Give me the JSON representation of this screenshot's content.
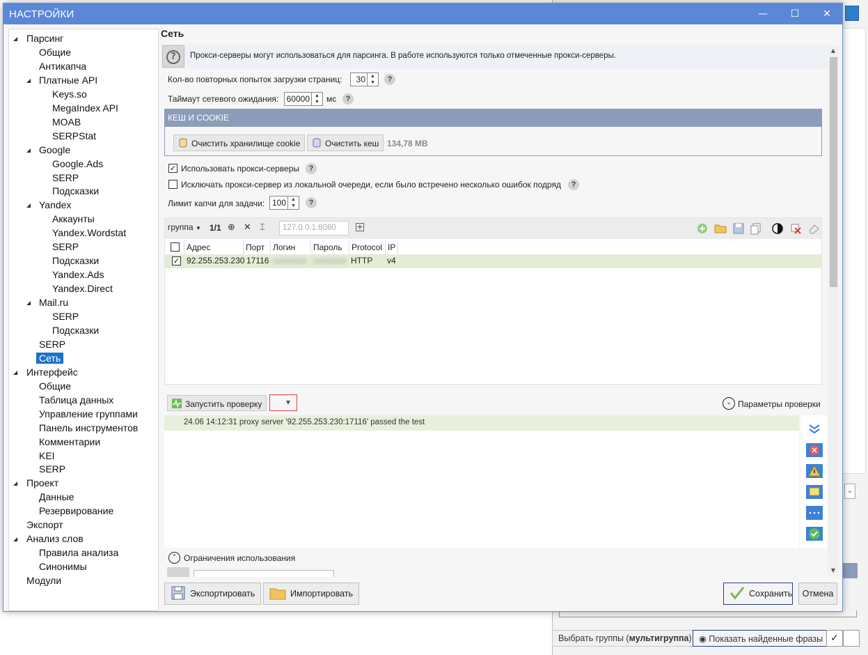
{
  "window": {
    "title": "НАСТРОЙКИ"
  },
  "tree": [
    {
      "label": "Парсинг",
      "level": 0,
      "expanded": true
    },
    {
      "label": "Общие",
      "level": 1
    },
    {
      "label": "Антикапча",
      "level": 1
    },
    {
      "label": "Платные API",
      "level": 1,
      "expanded": true
    },
    {
      "label": "Keys.so",
      "level": 2
    },
    {
      "label": "MegaIndex API",
      "level": 2
    },
    {
      "label": "MOAB",
      "level": 2
    },
    {
      "label": "SERPStat",
      "level": 2
    },
    {
      "label": "Google",
      "level": 1,
      "expanded": true
    },
    {
      "label": "Google.Ads",
      "level": 2
    },
    {
      "label": "SERP",
      "level": 2
    },
    {
      "label": "Подсказки",
      "level": 2
    },
    {
      "label": "Yandex",
      "level": 1,
      "expanded": true
    },
    {
      "label": "Аккаунты",
      "level": 2
    },
    {
      "label": "Yandex.Wordstat",
      "level": 2
    },
    {
      "label": "SERP",
      "level": 2
    },
    {
      "label": "Подсказки",
      "level": 2
    },
    {
      "label": "Yandex.Ads",
      "level": 2
    },
    {
      "label": "Yandex.Direct",
      "level": 2
    },
    {
      "label": "Mail.ru",
      "level": 1,
      "expanded": true
    },
    {
      "label": "SERP",
      "level": 2
    },
    {
      "label": "Подсказки",
      "level": 2
    },
    {
      "label": "SERP",
      "level": 1
    },
    {
      "label": "Сеть",
      "level": 1,
      "selected": true
    },
    {
      "label": "Интерфейс",
      "level": 0,
      "expanded": true
    },
    {
      "label": "Общие",
      "level": 1
    },
    {
      "label": "Таблица данных",
      "level": 1
    },
    {
      "label": "Управление группами",
      "level": 1
    },
    {
      "label": "Панель инструментов",
      "level": 1
    },
    {
      "label": "Комментарии",
      "level": 1
    },
    {
      "label": "KEI",
      "level": 1
    },
    {
      "label": "SERP",
      "level": 1
    },
    {
      "label": "Проект",
      "level": 0,
      "expanded": true
    },
    {
      "label": "Данные",
      "level": 1
    },
    {
      "label": "Резервирование",
      "level": 1
    },
    {
      "label": "Экспорт",
      "level": 0
    },
    {
      "label": "Анализ слов",
      "level": 0,
      "expanded": true
    },
    {
      "label": "Правила анализа",
      "level": 1
    },
    {
      "label": "Синонимы",
      "level": 1
    },
    {
      "label": "Модули",
      "level": 0
    }
  ],
  "section": {
    "title": "Сеть",
    "info": "Прокси-серверы могут использоваться для парсинга. В работе используются только отмеченные прокси-серверы.",
    "retries_label": "Кол-во повторных попыток загрузки страниц:",
    "retries_value": "30",
    "timeout_label": "Таймаут сетевого ожидания:",
    "timeout_value": "60000",
    "timeout_unit": "мс",
    "cache": {
      "header": "КЕШ И COOKIE",
      "clear_cookie": "Очистить хранилище cookie",
      "clear_cache": "Очистить кеш",
      "size": "134,78 MB"
    },
    "use_proxy_label": "Использовать прокси-серверы",
    "use_proxy_checked": true,
    "exclude_label": "Исключать прокси-сервер из локальной очереди, если было встречено несколько ошибок подряд",
    "exclude_checked": false,
    "captcha_label": "Лимит капчи для задачи:",
    "captcha_value": "100",
    "help": "?"
  },
  "proxy": {
    "group_label": "группа",
    "page_counter": "1/1",
    "address_placeholder": "127.0.0.1:8080",
    "columns": [
      "Адрес",
      "Порт",
      "Логин",
      "Пароль",
      "Protocol",
      "IP"
    ],
    "rows": [
      {
        "checked": true,
        "address": "92.255.253.230",
        "port": "17116",
        "login": "xxxxxxxx",
        "password": "xxxxxxxx",
        "protocol": "HTTP",
        "ip": "v4"
      }
    ]
  },
  "check": {
    "run_label": "Запустить проверку",
    "params_label": "Параметры проверки",
    "log": [
      "24.06 14:12:31  proxy server '92.255.253.230:17116' passed the test"
    ]
  },
  "limits_label": "Ограничения использования",
  "buttons": {
    "export": "Экспортировать",
    "import": "Импортировать",
    "save": "Сохранить",
    "cancel": "Отмена"
  },
  "background": {
    "select_groups_prefix": "Выбрать группы (",
    "select_groups_bold": "мультигруппа",
    "select_groups_suffix": ")",
    "show_found": "Показать найденные фразы"
  },
  "colors": {
    "titlebar": "#5a87d6",
    "selection": "#1a73c9",
    "cache_header": "#8c9dbb",
    "row_highlight": "#e3edd5"
  }
}
